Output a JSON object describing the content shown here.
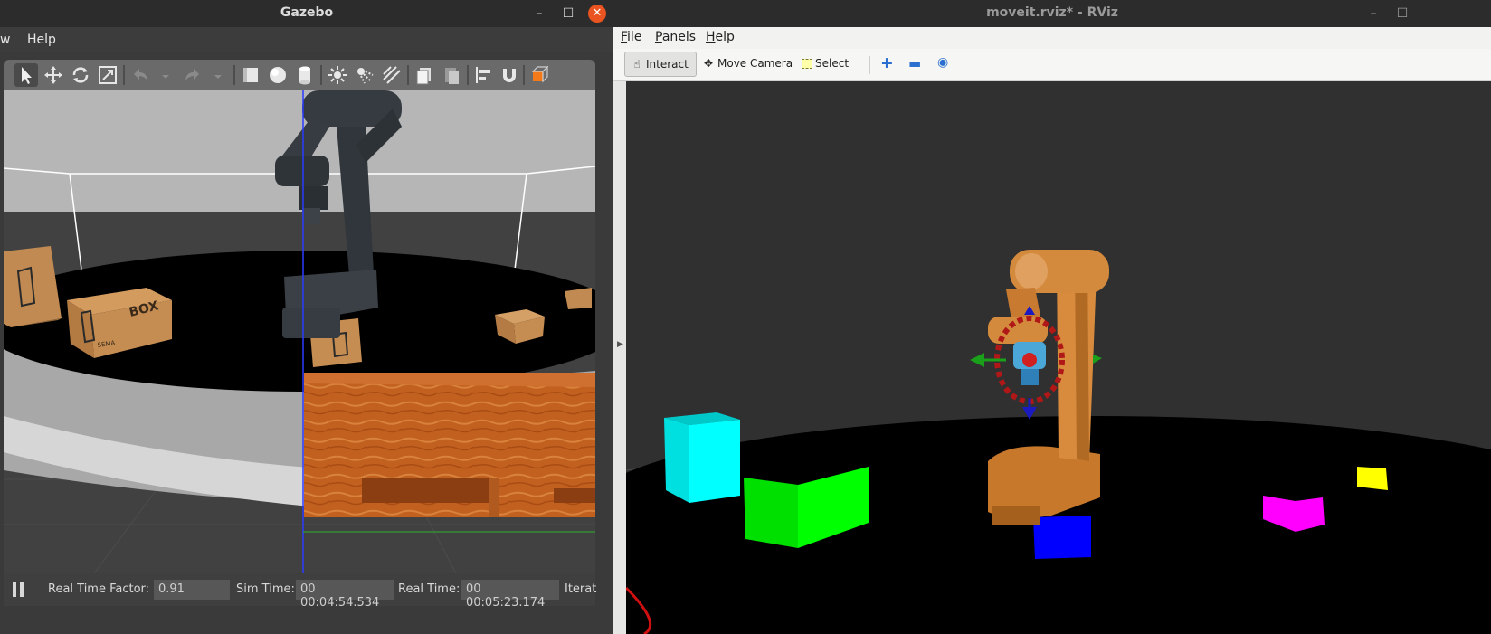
{
  "gazebo": {
    "title": "Gazebo",
    "menu": [
      "w",
      "Help"
    ],
    "window_buttons": {
      "minimize": "–",
      "maximize": "☐",
      "close": "✕"
    },
    "toolbar_icons": [
      "select-arrow-icon",
      "translate-icon",
      "rotate-icon",
      "scale-icon",
      "undo-icon",
      "undo-dropdown-icon",
      "redo-icon",
      "redo-dropdown-icon",
      "box-shape-icon",
      "sphere-shape-icon",
      "cylinder-shape-icon",
      "point-light-icon",
      "spot-light-icon",
      "directional-light-icon",
      "copy-icon",
      "paste-icon",
      "align-icon",
      "magnet-icon",
      "view-angle-icon"
    ],
    "status": {
      "pause_icon": "pause-icon",
      "real_time_factor_label": "Real Time Factor:",
      "real_time_factor_value": "0.91",
      "sim_time_label": "Sim Time:",
      "sim_time_value": "00 00:04:54.534",
      "real_time_label": "Real Time:",
      "real_time_value": "00 00:05:23.174",
      "iterations_label": "Iterat"
    },
    "box_labels": [
      "BOX",
      "SEMA"
    ]
  },
  "rviz": {
    "title": "moveit.rviz* - RViz",
    "window_buttons": {
      "minimize": "–",
      "maximize": "☐"
    },
    "menu": [
      {
        "u": "F",
        "rest": "ile"
      },
      {
        "u": "P",
        "rest": "anels"
      },
      {
        "u": "H",
        "rest": "elp"
      }
    ],
    "toolbar": {
      "interact": "Interact",
      "move_camera": "Move Camera",
      "select": "Select"
    },
    "colors": {
      "cyan": "#00ffff",
      "green": "#00ff00",
      "blue": "#0000ff",
      "magenta": "#ff00ff",
      "yellow": "#ffff00",
      "robot": "#d4883a"
    }
  }
}
